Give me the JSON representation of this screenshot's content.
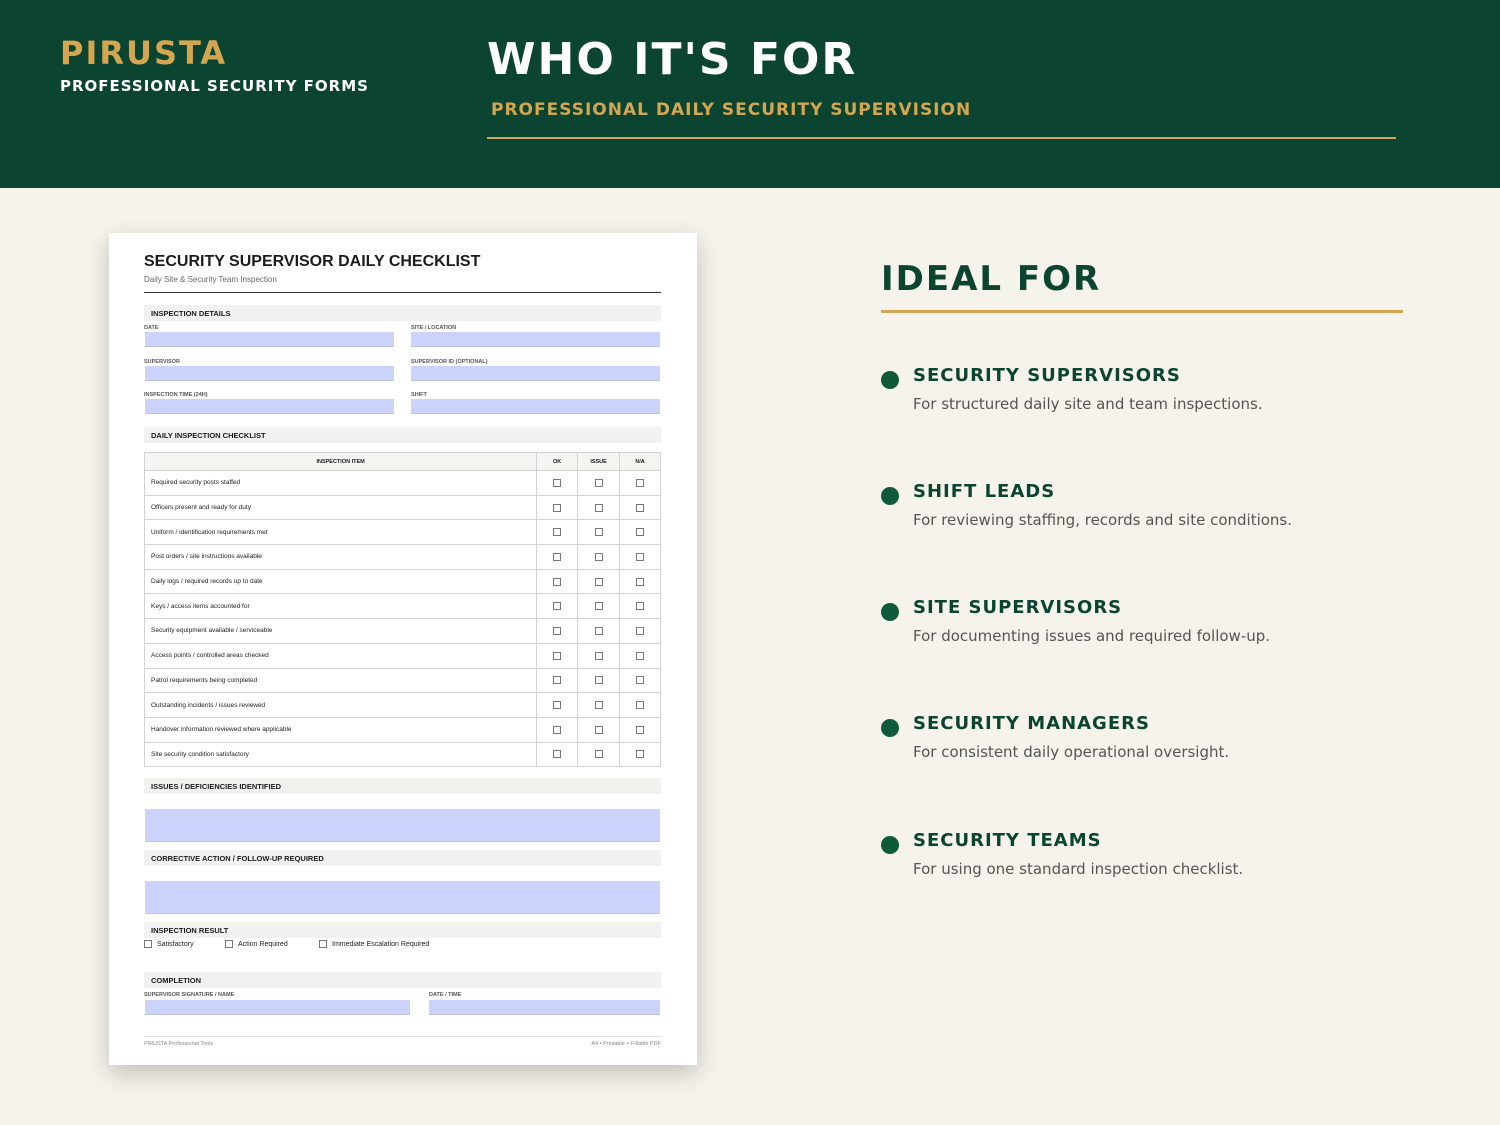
{
  "header": {
    "brand": "PIRUSTA",
    "brand_sub": "PROFESSIONAL SECURITY FORMS",
    "title": "WHO IT'S FOR",
    "subtitle": "PROFESSIONAL DAILY SECURITY SUPERVISION"
  },
  "form": {
    "title": "SECURITY SUPERVISOR DAILY CHECKLIST",
    "subtitle": "Daily Site & Security Team Inspection",
    "details_heading": "INSPECTION DETAILS",
    "fields": {
      "date": "DATE",
      "site": "SITE / LOCATION",
      "supervisor": "SUPERVISOR",
      "supervisor_id": "SUPERVISOR ID (OPTIONAL)",
      "time": "INSPECTION TIME (24H)",
      "shift": "SHIFT"
    },
    "checklist_heading": "DAILY INSPECTION CHECKLIST",
    "columns": {
      "item": "INSPECTION ITEM",
      "ok": "OK",
      "issue": "ISSUE",
      "na": "N/A"
    },
    "items": [
      "Required security posts staffed",
      "Officers present and ready for duty",
      "Uniform / identification requirements met",
      "Post orders / site instructions available",
      "Daily logs / required records up to date",
      "Keys / access items accounted for",
      "Security equipment available / serviceable",
      "Access points / controlled areas checked",
      "Patrol requirements being completed",
      "Outstanding incidents / issues reviewed",
      "Handover information reviewed where applicable",
      "Site security condition satisfactory"
    ],
    "issues_heading": "ISSUES / DEFICIENCIES IDENTIFIED",
    "corrective_heading": "CORRECTIVE ACTION / FOLLOW-UP REQUIRED",
    "result_heading": "INSPECTION RESULT",
    "result_options": [
      "Satisfactory",
      "Action Required",
      "Immediate Escalation Required"
    ],
    "completion_heading": "COMPLETION",
    "signature_label": "SUPERVISOR SIGNATURE / NAME",
    "datetime_label": "DATE / TIME",
    "footer_left": "PIRUSTA Professional Tools",
    "footer_right": "A4 • Printable + Fillable PDF"
  },
  "ideal": {
    "title": "IDEAL FOR",
    "items": [
      {
        "title": "SECURITY SUPERVISORS",
        "desc": "For structured daily site and team inspections."
      },
      {
        "title": "SHIFT LEADS",
        "desc": "For reviewing staffing, records and site conditions."
      },
      {
        "title": "SITE SUPERVISORS",
        "desc": "For documenting issues and required follow-up."
      },
      {
        "title": "SECURITY MANAGERS",
        "desc": "For consistent daily operational oversight."
      },
      {
        "title": "SECURITY TEAMS",
        "desc": "For using one standard inspection checklist."
      }
    ]
  },
  "colors": {
    "header_green": "#0b4430",
    "gold": "#d4a651",
    "background": "#f6f3ec",
    "field_fill": "#cbd2fb"
  }
}
